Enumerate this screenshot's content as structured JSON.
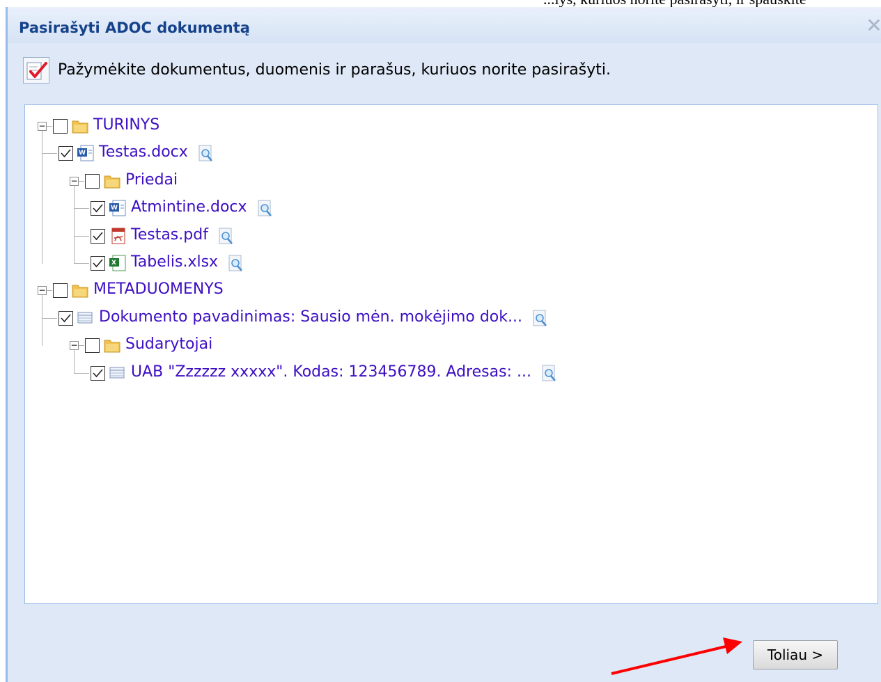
{
  "background_text": "...lys, kuriuos norite pasirašyti, ir spauskite",
  "dialog": {
    "title": "Pasirašyti ADOC dokumentą",
    "instruction": "Pažymėkite dokumentus, duomenis ir parašus, kuriuos norite pasirašyti.",
    "next_label": "Toliau >"
  },
  "tree": [
    {
      "label": "TURINYS",
      "type": "folder",
      "checked": false
    },
    {
      "label": "Testas.docx",
      "type": "word",
      "checked": true
    },
    {
      "label": "Priedai",
      "type": "folder",
      "checked": false
    },
    {
      "label": "Atmintine.docx",
      "type": "word",
      "checked": true
    },
    {
      "label": "Testas.pdf",
      "type": "pdf",
      "checked": true
    },
    {
      "label": "Tabelis.xlsx",
      "type": "excel",
      "checked": true
    },
    {
      "label": "METADUOMENYS",
      "type": "folder",
      "checked": false
    },
    {
      "label": "Dokumento pavadinimas: Sausio mėn. mokėjimo dok...",
      "type": "data",
      "checked": true
    },
    {
      "label": "Sudarytojai",
      "type": "folder",
      "checked": false
    },
    {
      "label": "UAB \"Zzzzzz xxxxx\". Kodas: 123456789. Adresas: ...",
      "type": "data",
      "checked": true
    }
  ],
  "colors": {
    "link_text": "#3d0fc2",
    "title_text": "#15428b",
    "dialog_bg": "#dfe8f6",
    "annotation_arrow": "#ff0000"
  }
}
